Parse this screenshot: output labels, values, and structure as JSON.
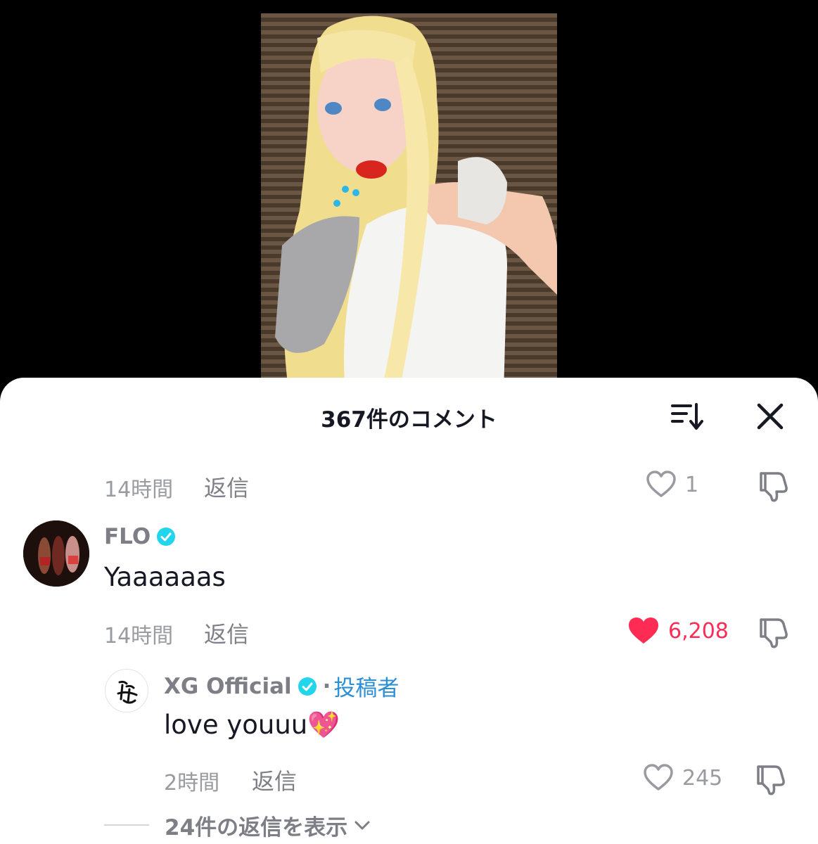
{
  "sheet": {
    "title": "367件のコメント",
    "sort_icon": "sort-descending-icon",
    "close_icon": "close-icon"
  },
  "comments": [
    {
      "time": "14時間",
      "reply_label": "返信",
      "likes": "1",
      "liked": false
    },
    {
      "username": "FLO",
      "verified": true,
      "text": "Yaaaaaas",
      "time": "14時間",
      "reply_label": "返信",
      "likes": "6,208",
      "liked": true,
      "replies": [
        {
          "username": "XG Official",
          "verified": true,
          "separator": "·",
          "author_tag": "投稿者",
          "text": "love youuu💖",
          "time": "2時間",
          "reply_label": "返信",
          "likes": "245",
          "liked": false
        }
      ],
      "view_replies_label": "24件の返信を表示"
    }
  ],
  "colors": {
    "like_active": "#fe2c55",
    "verified": "#20d5ec",
    "author_tag": "#2b8fd6",
    "muted_text": "#9a9ba1"
  }
}
